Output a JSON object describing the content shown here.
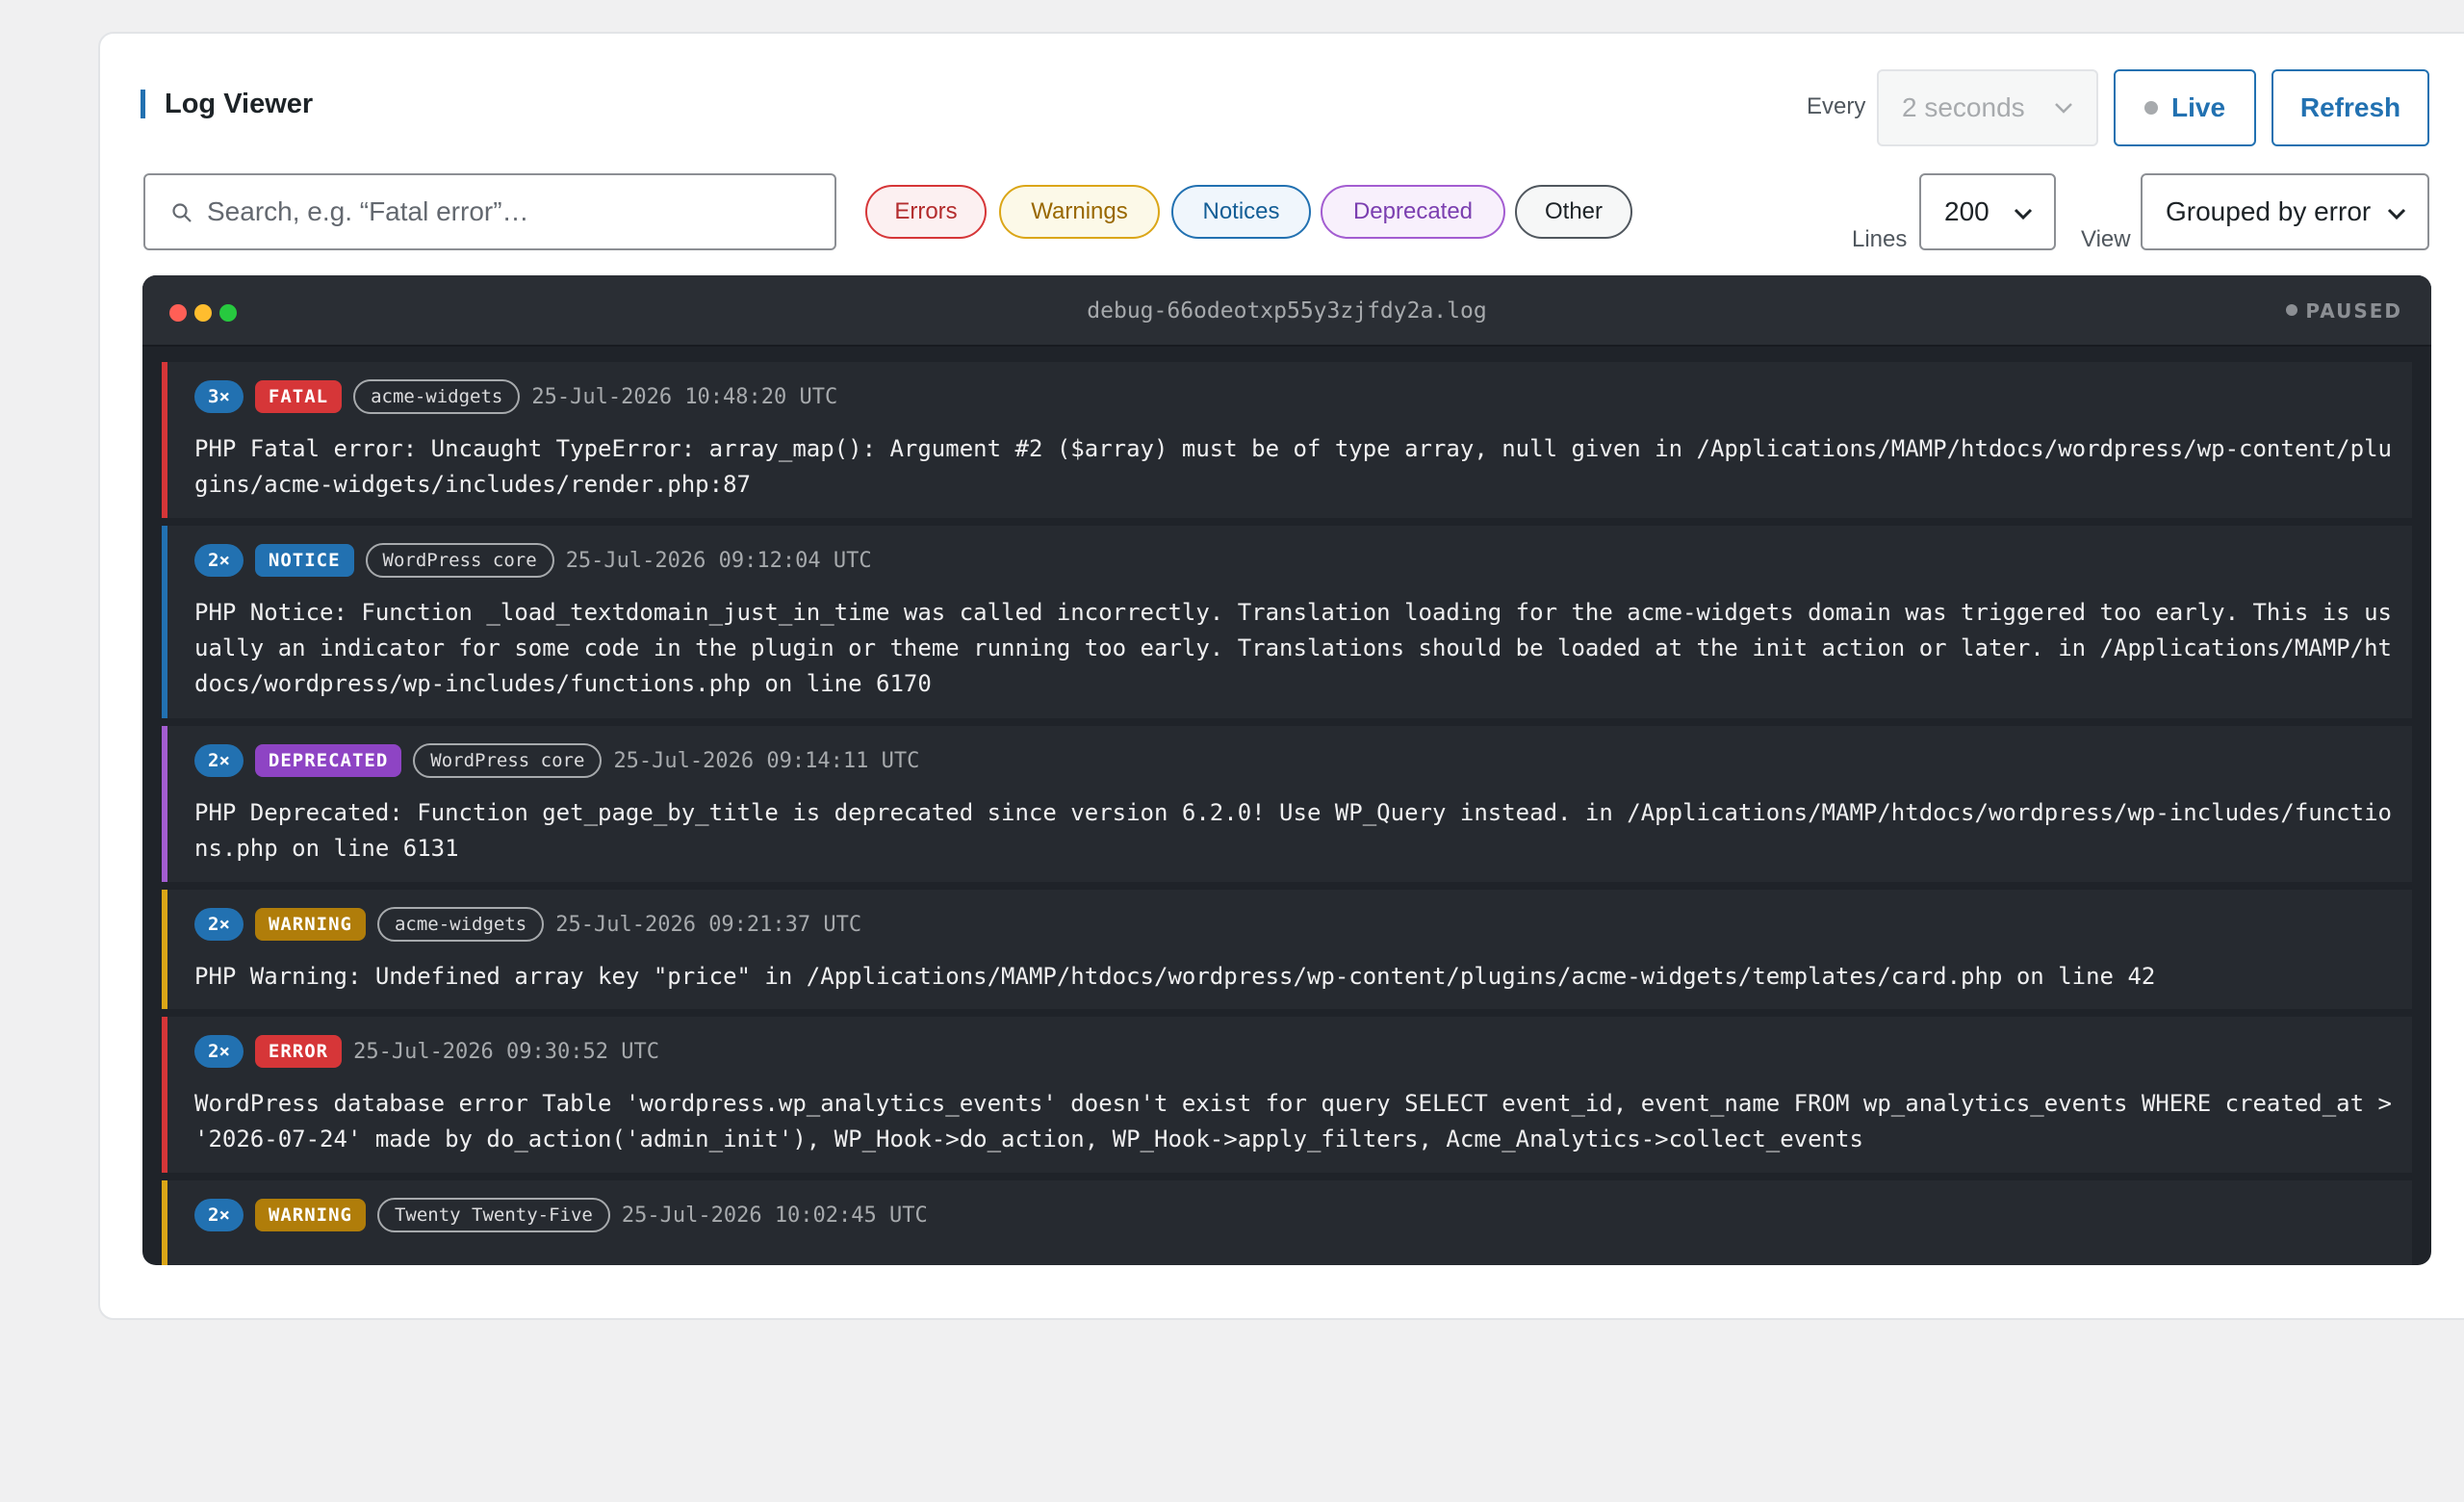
{
  "header": {
    "title": "Log Viewer",
    "every_label": "Every",
    "interval_value": "2 seconds",
    "live_label": "Live",
    "refresh_label": "Refresh"
  },
  "filters": {
    "search_placeholder": "Search, e.g. “Fatal error”…",
    "chips": [
      "Errors",
      "Warnings",
      "Notices",
      "Deprecated",
      "Other"
    ],
    "lines_label": "Lines",
    "lines_value": "200",
    "view_label": "View",
    "view_value": "Grouped by error"
  },
  "terminal": {
    "filename": "debug-66odeotxp55y3zjfdy2a.log",
    "status": "PAUSED",
    "entries": [
      {
        "count": "3×",
        "severity": "FATAL",
        "source": "acme-widgets",
        "timestamp": "25-Jul-2026 10:48:20 UTC",
        "message": "PHP Fatal error: Uncaught TypeError: array_map(): Argument #2 ($array) must be of type array, null given in /Applications/MAMP/htdocs/wordpress/wp-content/plugins/acme-widgets/includes/render.php:87"
      },
      {
        "count": "2×",
        "severity": "NOTICE",
        "source": "WordPress core",
        "timestamp": "25-Jul-2026 09:12:04 UTC",
        "message": "PHP Notice: Function _load_textdomain_just_in_time was called incorrectly. Translation loading for the acme-widgets domain was triggered too early. This is usually an indicator for some code in the plugin or theme running too early. Translations should be loaded at the init action or later. in /Applications/MAMP/htdocs/wordpress/wp-includes/functions.php on line 6170"
      },
      {
        "count": "2×",
        "severity": "DEPRECATED",
        "source": "WordPress core",
        "timestamp": "25-Jul-2026 09:14:11 UTC",
        "message": "PHP Deprecated: Function get_page_by_title is deprecated since version 6.2.0! Use WP_Query instead. in /Applications/MAMP/htdocs/wordpress/wp-includes/functions.php on line 6131"
      },
      {
        "count": "2×",
        "severity": "WARNING",
        "source": "acme-widgets",
        "timestamp": "25-Jul-2026 09:21:37 UTC",
        "message": "PHP Warning: Undefined array key \"price\" in /Applications/MAMP/htdocs/wordpress/wp-content/plugins/acme-widgets/templates/card.php on line 42"
      },
      {
        "count": "2×",
        "severity": "ERROR",
        "source": "",
        "timestamp": "25-Jul-2026 09:30:52 UTC",
        "message": "WordPress database error Table 'wordpress.wp_analytics_events' doesn't exist for query SELECT event_id, event_name FROM wp_analytics_events WHERE created_at > '2026-07-24' made by do_action('admin_init'), WP_Hook->do_action, WP_Hook->apply_filters, Acme_Analytics->collect_events"
      },
      {
        "count": "2×",
        "severity": "WARNING",
        "source": "Twenty Twenty-Five",
        "timestamp": "25-Jul-2026 10:02:45 UTC",
        "message": ""
      }
    ]
  }
}
